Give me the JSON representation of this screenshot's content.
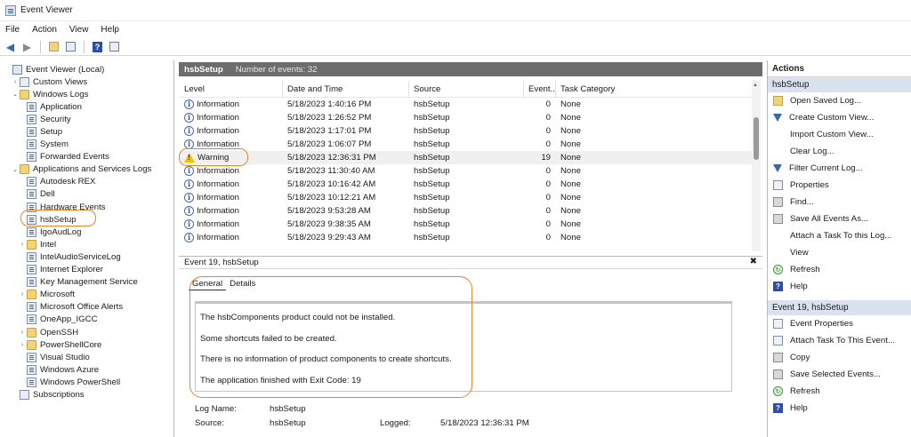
{
  "window": {
    "title": "Event Viewer"
  },
  "menu": [
    "File",
    "Action",
    "View",
    "Help"
  ],
  "tree": [
    {
      "label": "Event Viewer (Local)",
      "indent": 0,
      "arrow": "",
      "icon": "root"
    },
    {
      "label": "Custom Views",
      "indent": 1,
      "arrow": "›",
      "icon": "custom"
    },
    {
      "label": "Windows Logs",
      "indent": 1,
      "arrow": "⌄",
      "icon": "folder"
    },
    {
      "label": "Application",
      "indent": 2,
      "arrow": "",
      "icon": "log"
    },
    {
      "label": "Security",
      "indent": 2,
      "arrow": "",
      "icon": "log"
    },
    {
      "label": "Setup",
      "indent": 2,
      "arrow": "",
      "icon": "log"
    },
    {
      "label": "System",
      "indent": 2,
      "arrow": "",
      "icon": "log"
    },
    {
      "label": "Forwarded Events",
      "indent": 2,
      "arrow": "",
      "icon": "log"
    },
    {
      "label": "Applications and Services Logs",
      "indent": 1,
      "arrow": "⌄",
      "icon": "folder"
    },
    {
      "label": "Autodesk REX",
      "indent": 2,
      "arrow": "",
      "icon": "log"
    },
    {
      "label": "Dell",
      "indent": 2,
      "arrow": "",
      "icon": "log"
    },
    {
      "label": "Hardware Events",
      "indent": 2,
      "arrow": "",
      "icon": "log"
    },
    {
      "label": "hsbSetup",
      "indent": 2,
      "arrow": "",
      "icon": "log"
    },
    {
      "label": "IgoAudLog",
      "indent": 2,
      "arrow": "",
      "icon": "log"
    },
    {
      "label": "Intel",
      "indent": 2,
      "arrow": "›",
      "icon": "folder"
    },
    {
      "label": "IntelAudioServiceLog",
      "indent": 2,
      "arrow": "",
      "icon": "log"
    },
    {
      "label": "Internet Explorer",
      "indent": 2,
      "arrow": "",
      "icon": "log"
    },
    {
      "label": "Key Management Service",
      "indent": 2,
      "arrow": "",
      "icon": "log"
    },
    {
      "label": "Microsoft",
      "indent": 2,
      "arrow": "›",
      "icon": "folder"
    },
    {
      "label": "Microsoft Office Alerts",
      "indent": 2,
      "arrow": "",
      "icon": "log"
    },
    {
      "label": "OneApp_IGCC",
      "indent": 2,
      "arrow": "",
      "icon": "log"
    },
    {
      "label": "OpenSSH",
      "indent": 2,
      "arrow": "›",
      "icon": "folder"
    },
    {
      "label": "PowerShellCore",
      "indent": 2,
      "arrow": "›",
      "icon": "folder"
    },
    {
      "label": "Visual Studio",
      "indent": 2,
      "arrow": "",
      "icon": "log"
    },
    {
      "label": "Windows Azure",
      "indent": 2,
      "arrow": "",
      "icon": "log"
    },
    {
      "label": "Windows PowerShell",
      "indent": 2,
      "arrow": "",
      "icon": "log"
    },
    {
      "label": "Subscriptions",
      "indent": 1,
      "arrow": "",
      "icon": "custom"
    }
  ],
  "center_header": {
    "log": "hsbSetup",
    "count": "Number of events: 32"
  },
  "columns": [
    "Level",
    "Date and Time",
    "Source",
    "Event...",
    "Task Category"
  ],
  "events": [
    {
      "level": "Information",
      "date": "5/18/2023 1:40:16 PM",
      "source": "hsbSetup",
      "id": "0",
      "task": "None"
    },
    {
      "level": "Information",
      "date": "5/18/2023 1:26:52 PM",
      "source": "hsbSetup",
      "id": "0",
      "task": "None"
    },
    {
      "level": "Information",
      "date": "5/18/2023 1:17:01 PM",
      "source": "hsbSetup",
      "id": "0",
      "task": "None"
    },
    {
      "level": "Information",
      "date": "5/18/2023 1:06:07 PM",
      "source": "hsbSetup",
      "id": "0",
      "task": "None"
    },
    {
      "level": "Warning",
      "date": "5/18/2023 12:36:31 PM",
      "source": "hsbSetup",
      "id": "19",
      "task": "None"
    },
    {
      "level": "Information",
      "date": "5/18/2023 11:30:40 AM",
      "source": "hsbSetup",
      "id": "0",
      "task": "None"
    },
    {
      "level": "Information",
      "date": "5/18/2023 10:16:42 AM",
      "source": "hsbSetup",
      "id": "0",
      "task": "None"
    },
    {
      "level": "Information",
      "date": "5/18/2023 10:12:21 AM",
      "source": "hsbSetup",
      "id": "0",
      "task": "None"
    },
    {
      "level": "Information",
      "date": "5/18/2023 9:53:28 AM",
      "source": "hsbSetup",
      "id": "0",
      "task": "None"
    },
    {
      "level": "Information",
      "date": "5/18/2023 9:38:35 AM",
      "source": "hsbSetup",
      "id": "0",
      "task": "None"
    },
    {
      "level": "Information",
      "date": "5/18/2023 9:29:43 AM",
      "source": "hsbSetup",
      "id": "0",
      "task": "None"
    }
  ],
  "detail": {
    "header": "Event 19, hsbSetup",
    "tabs": [
      "General",
      "Details"
    ],
    "messages": [
      "The hsbComponents product could not be installed.",
      "Some shortcuts failed to be created.",
      "There is no information of product components to create shortcuts.",
      "The application finished with Exit Code: 19"
    ],
    "fields": {
      "log_name_label": "Log Name:",
      "log_name": "hsbSetup",
      "source_label": "Source:",
      "source": "hsbSetup",
      "logged_label": "Logged:",
      "logged": "5/18/2023 12:36:31 PM"
    }
  },
  "actions": {
    "title": "Actions",
    "section1": "hsbSetup",
    "items1": [
      {
        "label": "Open Saved Log...",
        "icon": "folder"
      },
      {
        "label": "Create Custom View...",
        "icon": "filter"
      },
      {
        "label": "Import Custom View...",
        "icon": "blank"
      },
      {
        "label": "Clear Log...",
        "icon": "blank"
      },
      {
        "label": "Filter Current Log...",
        "icon": "filter"
      },
      {
        "label": "Properties",
        "icon": "box"
      },
      {
        "label": "Find...",
        "icon": "gray"
      },
      {
        "label": "Save All Events As...",
        "icon": "gray"
      },
      {
        "label": "Attach a Task To this Log...",
        "icon": "blank"
      },
      {
        "label": "View",
        "icon": "blank"
      },
      {
        "label": "Refresh",
        "icon": "refresh"
      },
      {
        "label": "Help",
        "icon": "helpi"
      }
    ],
    "section2": "Event 19, hsbSetup",
    "items2": [
      {
        "label": "Event Properties",
        "icon": "box"
      },
      {
        "label": "Attach Task To This Event...",
        "icon": "box"
      },
      {
        "label": "Copy",
        "icon": "gray"
      },
      {
        "label": "Save Selected Events...",
        "icon": "gray"
      },
      {
        "label": "Refresh",
        "icon": "refresh"
      },
      {
        "label": "Help",
        "icon": "helpi"
      }
    ]
  },
  "colors": {
    "highlight": "#e9822e",
    "header_gray": "#6d6d6d",
    "action_section": "#d9e2ee"
  }
}
